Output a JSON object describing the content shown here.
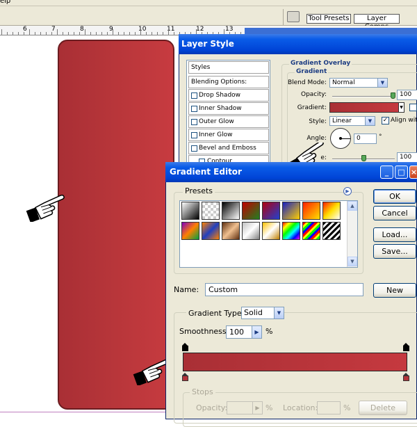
{
  "menubar": {
    "fragment": "elp"
  },
  "palette_well": {
    "tabs": [
      "Tool Presets",
      "Layer Comps"
    ]
  },
  "ruler": {
    "labels": [
      "6",
      "7",
      "8",
      "9",
      "10",
      "11",
      "12",
      "13"
    ]
  },
  "layer_style": {
    "title": "Layer Style",
    "list_items": [
      {
        "label": "Styles",
        "checkbox": false
      },
      {
        "label": "Blending Options: Default",
        "checkbox": false
      },
      {
        "label": "Drop Shadow",
        "checkbox": true,
        "checked": false
      },
      {
        "label": "Inner Shadow",
        "checkbox": true,
        "checked": false
      },
      {
        "label": "Outer Glow",
        "checkbox": true,
        "checked": false
      },
      {
        "label": "Inner Glow",
        "checkbox": true,
        "checked": false
      },
      {
        "label": "Bevel and Emboss",
        "checkbox": true,
        "checked": false
      },
      {
        "label": "Contour",
        "checkbox": true,
        "checked": false
      }
    ],
    "section_title": "Gradient Overlay",
    "group_title": "Gradient",
    "blend_mode_label": "Blend Mode:",
    "blend_mode_value": "Normal",
    "opacity_label": "Opacity:",
    "opacity_value": "100",
    "opacity_fraction": 1.0,
    "gradient_label": "Gradient:",
    "style_label": "Style:",
    "style_value": "Linear",
    "align_label": "Align with",
    "align_checked": true,
    "angle_label": "Angle:",
    "angle_value": "0",
    "angle_unit": "°",
    "scale_label_fragment": "e:",
    "scale_value": "100",
    "scale_fraction": 0.5
  },
  "gradient_editor": {
    "title": "Gradient Editor",
    "title_buttons": [
      "_",
      "□",
      "×"
    ],
    "presets_label": "Presets",
    "buttons": {
      "ok": "OK",
      "cancel": "Cancel",
      "load": "Load...",
      "save": "Save...",
      "new": "New"
    },
    "name_label": "Name:",
    "name_value": "Custom",
    "gradient_type_label": "Gradient Type:",
    "gradient_type_value": "Solid",
    "smoothness_label": "Smoothness:",
    "smoothness_value": "100",
    "smoothness_unit": "%",
    "stops": {
      "group_label": "Stops",
      "opacity_label": "Opacity:",
      "opacity_unit": "%",
      "location_label": "Location:",
      "location_unit": "%",
      "delete_label": "Delete"
    },
    "gradient": {
      "start_color": "#a92f35",
      "end_color": "#c5393f"
    }
  },
  "colors": {
    "title_bar": "#0a5ce8",
    "dialog_bg": "#ece9d8",
    "shape_red": "#b8363a",
    "shape_border": "#6b1c20"
  }
}
